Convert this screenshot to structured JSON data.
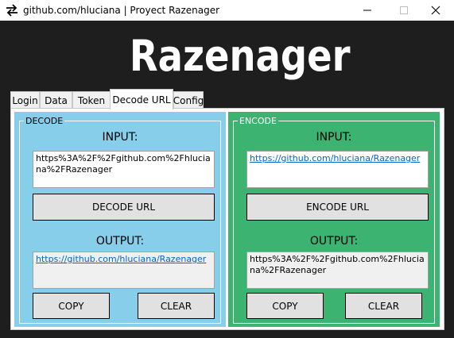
{
  "window": {
    "title": "github.com/hluciana | Proyect Razenager",
    "minimize_icon": "minimize-icon",
    "maximize_icon": "maximize-icon",
    "close_icon": "close-icon"
  },
  "app_title": "Razenager",
  "tabs": [
    {
      "label": "Login"
    },
    {
      "label": "Data"
    },
    {
      "label": "Token"
    },
    {
      "label": "Decode URL",
      "active": true
    },
    {
      "label": "Config"
    }
  ],
  "decode": {
    "legend": "DECODE",
    "input_label": "INPUT:",
    "input_value": "https%3A%2F%2Fgithub.com%2Fhluciana%2FRazenager",
    "action_label": "DECODE URL",
    "output_label": "OUTPUT:",
    "output_value": "https://github.com/hluciana/Razenager",
    "copy_label": "COPY",
    "clear_label": "CLEAR"
  },
  "encode": {
    "legend": "ENCODE",
    "input_label": "INPUT:",
    "input_value": "https://github.com/hluciana/Razenager",
    "action_label": "ENCODE URL",
    "output_label": "OUTPUT:",
    "output_value": "https%3A%2F%2Fgithub.com%2Fhluciana%2FRazenager",
    "copy_label": "COPY",
    "clear_label": "CLEAR"
  },
  "colors": {
    "background": "#1e1e1e",
    "decode_panel": "#87ceeb",
    "encode_panel": "#3cb371",
    "link": "#0066cc"
  }
}
